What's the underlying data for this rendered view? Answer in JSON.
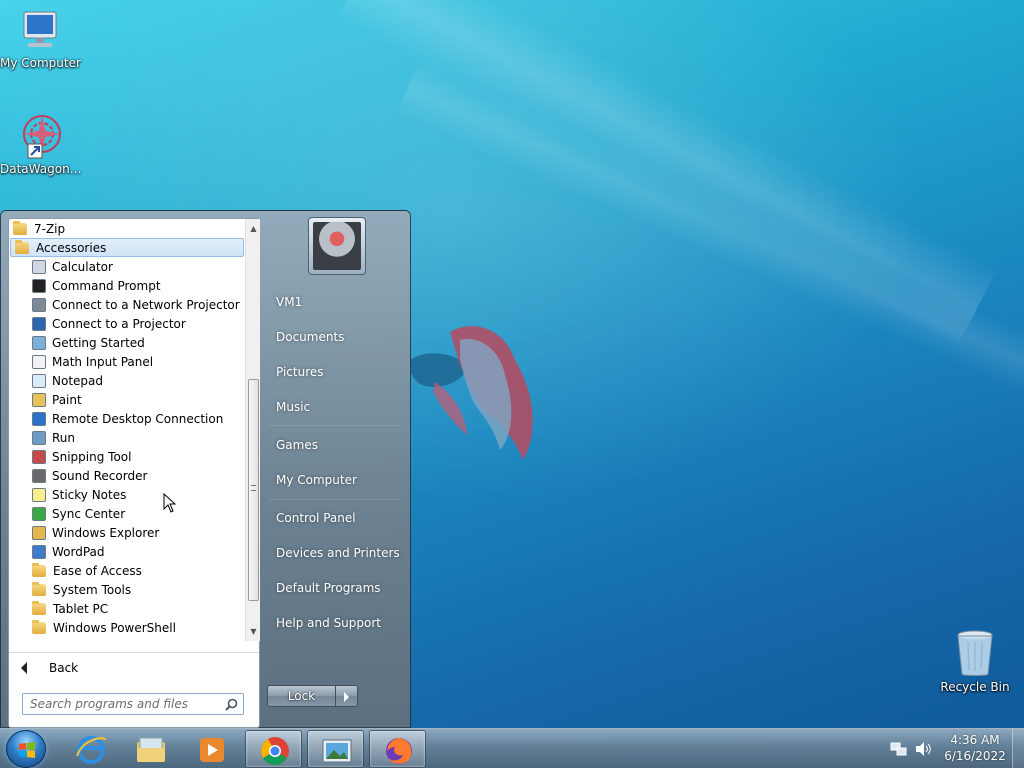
{
  "desktop": {
    "icons": [
      {
        "label": "My Computer"
      },
      {
        "label": "DataWagon…"
      },
      {
        "label": "Recycle Bin"
      }
    ]
  },
  "start_menu": {
    "programs": [
      {
        "label": "7-Zip",
        "type": "folder",
        "level": 0
      },
      {
        "label": "Accessories",
        "type": "folder",
        "level": 0,
        "selected": true
      },
      {
        "label": "Calculator",
        "type": "app",
        "level": 1,
        "icon": "calculator-icon"
      },
      {
        "label": "Command Prompt",
        "type": "app",
        "level": 1,
        "icon": "command-prompt-icon"
      },
      {
        "label": "Connect to a Network Projector",
        "type": "app",
        "level": 1,
        "icon": "network-projector-icon"
      },
      {
        "label": "Connect to a Projector",
        "type": "app",
        "level": 1,
        "icon": "projector-icon"
      },
      {
        "label": "Getting Started",
        "type": "app",
        "level": 1,
        "icon": "getting-started-icon"
      },
      {
        "label": "Math Input Panel",
        "type": "app",
        "level": 1,
        "icon": "math-input-icon"
      },
      {
        "label": "Notepad",
        "type": "app",
        "level": 1,
        "icon": "notepad-icon"
      },
      {
        "label": "Paint",
        "type": "app",
        "level": 1,
        "icon": "paint-icon"
      },
      {
        "label": "Remote Desktop Connection",
        "type": "app",
        "level": 1,
        "icon": "remote-desktop-icon"
      },
      {
        "label": "Run",
        "type": "app",
        "level": 1,
        "icon": "run-icon"
      },
      {
        "label": "Snipping Tool",
        "type": "app",
        "level": 1,
        "icon": "snipping-tool-icon"
      },
      {
        "label": "Sound Recorder",
        "type": "app",
        "level": 1,
        "icon": "microphone-icon"
      },
      {
        "label": "Sticky Notes",
        "type": "app",
        "level": 1,
        "icon": "sticky-notes-icon"
      },
      {
        "label": "Sync Center",
        "type": "app",
        "level": 1,
        "icon": "sync-center-icon"
      },
      {
        "label": "Windows Explorer",
        "type": "app",
        "level": 1,
        "icon": "explorer-icon"
      },
      {
        "label": "WordPad",
        "type": "app",
        "level": 1,
        "icon": "wordpad-icon"
      },
      {
        "label": "Ease of Access",
        "type": "folder",
        "level": 1
      },
      {
        "label": "System Tools",
        "type": "folder",
        "level": 1
      },
      {
        "label": "Tablet PC",
        "type": "folder",
        "level": 1
      },
      {
        "label": "Windows PowerShell",
        "type": "folder",
        "level": 1
      }
    ],
    "back_label": "Back",
    "search_placeholder": "Search programs and files",
    "right_items": [
      {
        "label": "VM1"
      },
      {
        "label": "Documents"
      },
      {
        "label": "Pictures"
      },
      {
        "label": "Music"
      },
      {
        "label": "Games"
      },
      {
        "label": "My Computer"
      },
      {
        "label": "Control Panel"
      },
      {
        "label": "Devices and Printers"
      },
      {
        "label": "Default Programs"
      },
      {
        "label": "Help and Support"
      }
    ],
    "lock_label": "Lock"
  },
  "taskbar": {
    "pinned": [
      {
        "icon": "internet-explorer-icon"
      },
      {
        "icon": "file-explorer-icon"
      },
      {
        "icon": "media-player-icon"
      },
      {
        "icon": "chrome-icon",
        "active": true
      },
      {
        "icon": "picture-viewer-icon",
        "active": true
      },
      {
        "icon": "firefox-icon",
        "active": true
      }
    ],
    "clock_time": "4:36 AM",
    "clock_date": "6/16/2022"
  }
}
